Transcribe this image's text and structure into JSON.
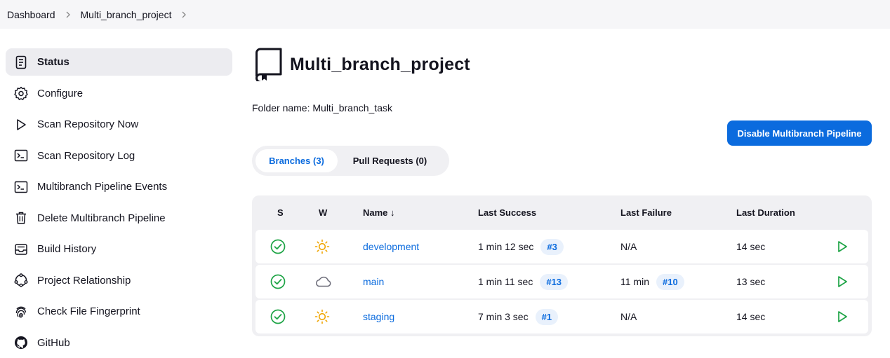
{
  "breadcrumb": {
    "items": [
      {
        "label": "Dashboard"
      },
      {
        "label": "Multi_branch_project"
      }
    ]
  },
  "sidebar": {
    "items": [
      {
        "label": "Status",
        "icon": "document-icon",
        "active": true
      },
      {
        "label": "Configure",
        "icon": "gear-icon"
      },
      {
        "label": "Scan Repository Now",
        "icon": "play-icon"
      },
      {
        "label": "Scan Repository Log",
        "icon": "terminal-icon"
      },
      {
        "label": "Multibranch Pipeline Events",
        "icon": "terminal-icon"
      },
      {
        "label": "Delete Multibranch Pipeline",
        "icon": "trash-icon"
      },
      {
        "label": "Build History",
        "icon": "inbox-icon"
      },
      {
        "label": "Project Relationship",
        "icon": "relationship-icon"
      },
      {
        "label": "Check File Fingerprint",
        "icon": "fingerprint-icon"
      },
      {
        "label": "GitHub",
        "icon": "github-icon"
      }
    ]
  },
  "main": {
    "title": "Multi_branch_project",
    "folder_name": "Folder name: Multi_branch_task",
    "disable_button": "Disable Multibranch Pipeline",
    "tabs": [
      {
        "label": "Branches (3)",
        "active": true
      },
      {
        "label": "Pull Requests (0)",
        "active": false
      }
    ]
  },
  "table": {
    "headers": {
      "s": "S",
      "w": "W",
      "name": "Name ↓",
      "last_success": "Last Success",
      "last_failure": "Last Failure",
      "last_duration": "Last Duration"
    },
    "rows": [
      {
        "status_icon": "success-check-icon",
        "weather_icon": "sun-icon",
        "name": "development",
        "last_success": "1 min 12 sec",
        "success_build": "#3",
        "last_failure": "N/A",
        "failure_build": "",
        "last_duration": "14 sec"
      },
      {
        "status_icon": "success-check-icon",
        "weather_icon": "cloud-icon",
        "name": "main",
        "last_success": "1 min 11 sec",
        "success_build": "#13",
        "last_failure": "11 min",
        "failure_build": "#10",
        "last_duration": "13 sec"
      },
      {
        "status_icon": "success-check-icon",
        "weather_icon": "sun-icon",
        "name": "staging",
        "last_success": "7 min 3 sec",
        "success_build": "#1",
        "last_failure": "N/A",
        "failure_build": "",
        "last_duration": "14 sec"
      }
    ]
  },
  "colors": {
    "accent": "#0b6bde",
    "success": "#1ea446",
    "sun": "#f0a500",
    "cloud": "#6b6b78"
  }
}
